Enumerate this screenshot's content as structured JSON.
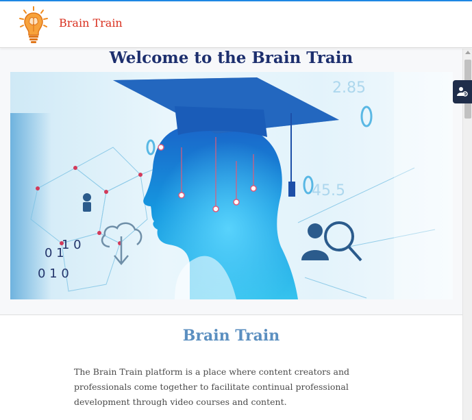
{
  "header": {
    "brand_name": "Brain Train",
    "logo_icon": "lightbulb-brain-icon"
  },
  "main": {
    "welcome_title": "Welcome to the Brain Train",
    "hero_icon": "graduate-silhouette-illustration"
  },
  "about": {
    "title": "Brain Train",
    "text": "The Brain Train platform is a place where content creators and professionals come together to facilitate continual professional development through video courses and content."
  },
  "accessibility": {
    "icon": "user-settings-icon"
  },
  "colors": {
    "brand": "#d9301f",
    "welcome": "#1d2f6e",
    "section_title": "#5b8fc0",
    "top_line": "#1e88e5",
    "access_button": "#1f2d4a"
  }
}
